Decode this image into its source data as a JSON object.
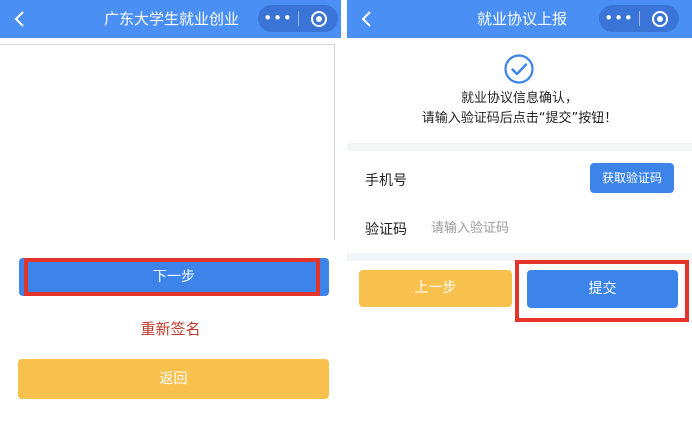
{
  "left": {
    "title": "广东大学生就业创业",
    "back_icon": "chevron-left-icon",
    "capsule": {
      "more": "•••",
      "more_icon": "more-icon",
      "record_icon": "record-icon"
    },
    "next_label": "下一步",
    "resign_label": "重新签名",
    "back_label": "返回"
  },
  "right": {
    "title": "就业协议上报",
    "back_icon": "chevron-left-icon",
    "capsule": {
      "more": "•••",
      "more_icon": "more-icon",
      "record_icon": "record-icon"
    },
    "confirm_icon": "check-circle-icon",
    "message_line1": "就业协议信息确认，",
    "message_line2": "请输入验证码后点击“提交”按钮！",
    "phone_label": "手机号",
    "get_code_label": "获取验证码",
    "code_label": "验证码",
    "code_placeholder": "请输入验证码",
    "prev_label": "上一步",
    "submit_label": "提交"
  },
  "colors": {
    "navbar": "#4a8ff3",
    "primary_button": "#3d84ea",
    "secondary_button": "#f8c04d",
    "highlight": "#e4332b",
    "resign_text": "#c0392b"
  }
}
